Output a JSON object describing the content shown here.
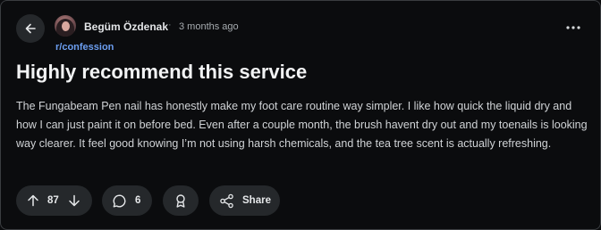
{
  "post": {
    "author": "Begüm Özdenak",
    "separator": "·",
    "time_ago": "3 months ago",
    "subreddit": "r/confession",
    "title": "Highly recommend this service",
    "body": "The Fungabeam Pen nail has honestly make my foot care routine way simpler. I like how quick the liquid dry and how I can just paint it on before bed. Even after a couple month, the brush havent dry out and my toenails is looking way clearer. It feel good knowing I’m not using harsh chemicals, and the tea tree scent is actually refreshing."
  },
  "actions": {
    "vote_count": "87",
    "comment_count": "6",
    "share_label": "Share"
  },
  "icons": {
    "back": "arrow-left-icon",
    "more": "more-horizontal-icon",
    "upvote": "arrow-up-icon",
    "downvote": "arrow-down-icon",
    "comment": "comment-bubble-icon",
    "award": "award-icon",
    "share": "share-icon"
  },
  "colors": {
    "background": "#0b0c0e",
    "pill": "#25282b",
    "subreddit_link": "#6c9ef0",
    "title_text": "#f2f3f4",
    "body_text": "#d0d3d6"
  }
}
